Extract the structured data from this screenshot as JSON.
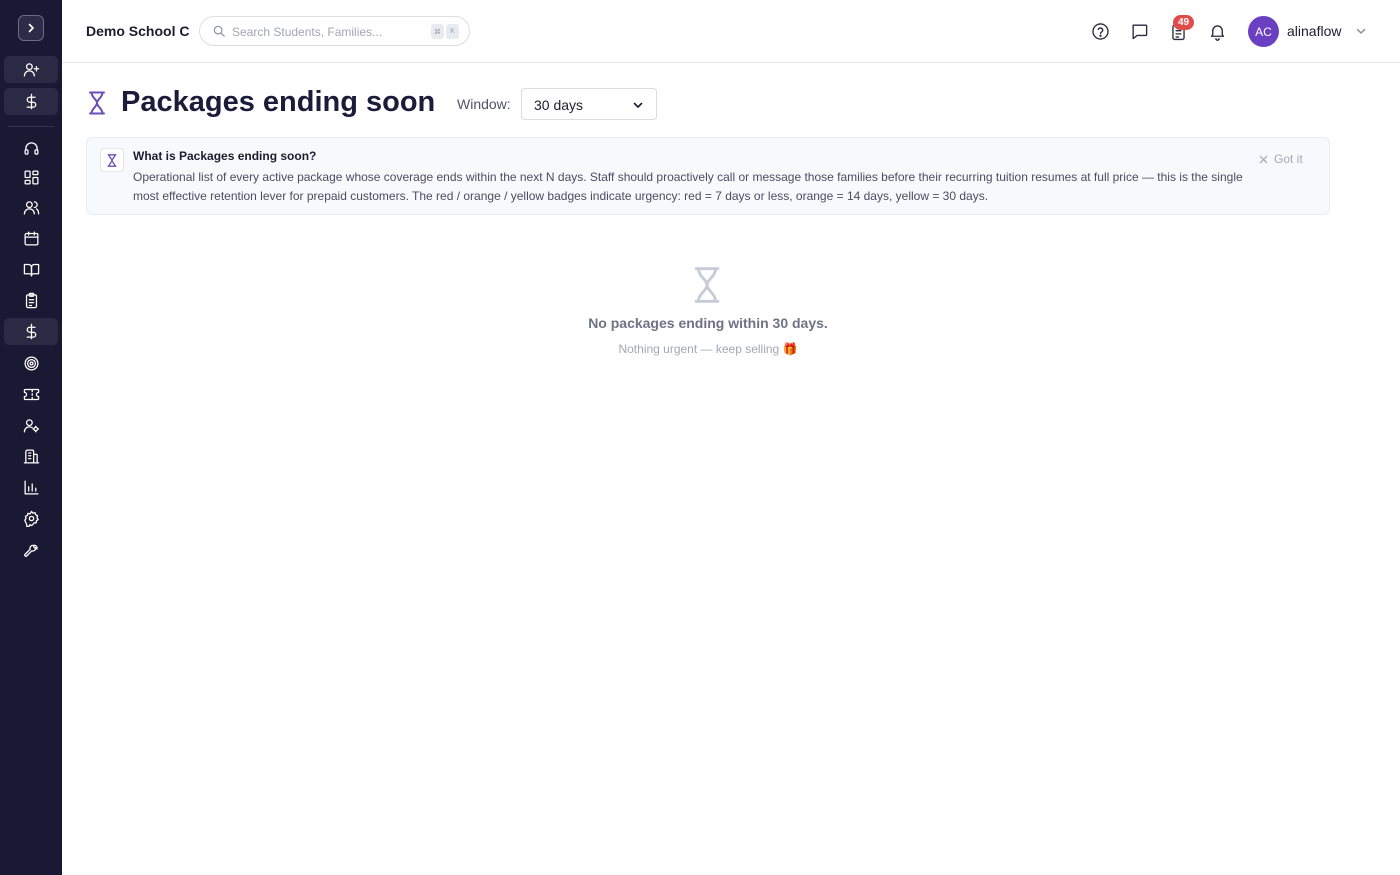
{
  "header": {
    "school_name": "Demo School C",
    "search_placeholder": "Search Students, Families...",
    "search_shortcut": [
      "⌘",
      "K"
    ],
    "notifications_badge": "49",
    "user": {
      "initials": "AC",
      "name": "alinaflow"
    }
  },
  "sidebar": {
    "toggle_icon": "chevron-right-icon",
    "items": [
      {
        "icon": "add-user-icon",
        "boxed": true
      },
      {
        "icon": "dollar-icon",
        "boxed": true
      },
      {
        "icon": "headset-icon",
        "boxed": false
      },
      {
        "icon": "dashboard-grid-icon",
        "boxed": false
      },
      {
        "icon": "users-icon",
        "boxed": false
      },
      {
        "icon": "calendar-icon",
        "boxed": false
      },
      {
        "icon": "book-icon",
        "boxed": false
      },
      {
        "icon": "clipboard-icon",
        "boxed": false
      },
      {
        "icon": "dollar-icon",
        "boxed": true
      },
      {
        "icon": "target-icon",
        "boxed": false
      },
      {
        "icon": "ticket-icon",
        "boxed": false
      },
      {
        "icon": "user-settings-icon",
        "boxed": false
      },
      {
        "icon": "building-icon",
        "boxed": false
      },
      {
        "icon": "bar-chart-icon",
        "boxed": false
      },
      {
        "icon": "gear-icon",
        "boxed": false
      },
      {
        "icon": "wrench-icon",
        "boxed": false
      }
    ]
  },
  "page": {
    "title": "Packages ending soon",
    "window_label": "Window:",
    "window_value": "30 days"
  },
  "info": {
    "title": "What is Packages ending soon?",
    "body": "Operational list of every active package whose coverage ends within the next N days. Staff should proactively call or message those families before their recurring tuition resumes at full price — this is the single most effective retention lever for prepaid customers. The red / orange / yellow badges indicate urgency: red = 7 days or less, orange = 14 days, yellow = 30 days.",
    "dismiss_label": "Got it"
  },
  "empty_state": {
    "title": "No packages ending within 30 days.",
    "subtitle": "Nothing urgent — keep selling 🎁"
  },
  "colors": {
    "sidebar_bg": "#191933",
    "accent_purple": "#6b3fc2",
    "badge_red": "#e04b4b"
  }
}
